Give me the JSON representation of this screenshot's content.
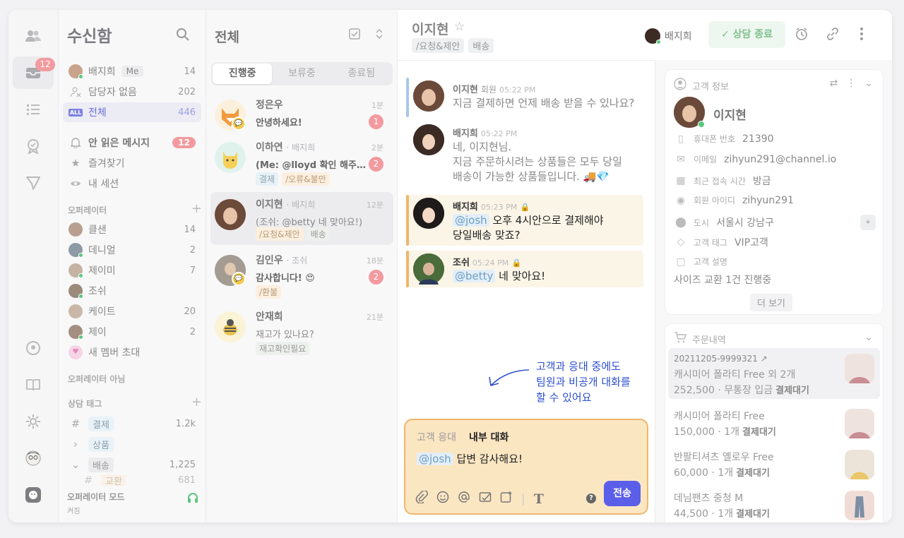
{
  "rail": {
    "inbox_badge": "12"
  },
  "sidebar": {
    "title": "수신함",
    "rows": [
      {
        "label": "배지희",
        "me": "Me",
        "count": "14"
      },
      {
        "label": "담당자 없음",
        "count": "202"
      },
      {
        "label": "전체",
        "count": "446"
      }
    ],
    "unread": {
      "label": "안 읽은 메시지",
      "badge": "12"
    },
    "favorites": "즐겨찾기",
    "my_session": "내 세션",
    "operators_title": "오퍼레이터",
    "operators": [
      {
        "name": "클샌",
        "count": "14"
      },
      {
        "name": "데니얼",
        "count": "2"
      },
      {
        "name": "제이미",
        "count": "7"
      },
      {
        "name": "조쉬",
        "count": ""
      },
      {
        "name": "케이트",
        "count": "20"
      },
      {
        "name": "제이",
        "count": "2"
      }
    ],
    "invite": "새 멤버 초대",
    "not_operator": "오퍼레이터 아님",
    "tags_title": "상담 태그",
    "tags": [
      {
        "label": "결제",
        "count": "1.2k"
      },
      {
        "label": "상품",
        "count": ""
      },
      {
        "label": "배송",
        "count": "1,225"
      },
      {
        "label": "교환",
        "count": "681"
      }
    ],
    "footer_title": "오퍼레이터 모드",
    "footer_sub": "켜짐"
  },
  "clist": {
    "title": "전체",
    "tabs": [
      "진행중",
      "보류중",
      "종료됨"
    ],
    "items": [
      {
        "name": "정은우",
        "sub": "",
        "time": "1분",
        "msg": "안녕하세요!",
        "badge": "1",
        "tags": []
      },
      {
        "name": "이하연",
        "sub": "· 배지희",
        "time": "2분",
        "msg": "(Me: @lloyd 확인 해주실...",
        "badge": "2",
        "tags": [
          "결제",
          "/오류&불만"
        ]
      },
      {
        "name": "이지현",
        "sub": "· 배지희",
        "time": "12분",
        "msg": "(조쉬: @betty 네 맞아요!)",
        "badge": "",
        "tags": [
          "/요청&제안",
          "배송"
        ]
      },
      {
        "name": "김인우",
        "sub": "· 조쉬",
        "time": "18분",
        "msg": "감사합니다! 😍",
        "badge": "2",
        "tags": [
          "/환불"
        ]
      },
      {
        "name": "안재희",
        "sub": "",
        "time": "21분",
        "msg": "재고가 있나요?",
        "badge": "",
        "tags": [
          "재고확인필요"
        ]
      }
    ]
  },
  "chat": {
    "name": "이지현",
    "tags": [
      "/요청&제안",
      "배송"
    ],
    "messages": [
      {
        "who": "이지현",
        "role": "회원",
        "time": "05:22 PM",
        "text": "지금 결제하면 언제 배송 받을 수 있나요?"
      },
      {
        "who": "배지희",
        "role": "",
        "time": "05:22 PM",
        "l1": "네, 이지현님.",
        "l2": "지금 주문하시려는 상품들은 모두 당일",
        "l3": "배송이 가능한 상품들입니다. 🚚💎"
      },
      {
        "who": "배지희",
        "role": "",
        "time": "05:23 PM",
        "mention": "@josh",
        "l1": " 오후 4시안으로 결제해야",
        "l2": "당일배송 맞죠?"
      },
      {
        "who": "조쉬",
        "role": "",
        "time": "05:24 PM",
        "mention": "@betty",
        "l1": " 네 맞아요!"
      }
    ],
    "note": [
      "고객과 응대 중에도",
      "팀원과 비공개 대화를",
      "할 수 있어요"
    ],
    "composer": {
      "tab_customer": "고객 응대",
      "tab_internal": "내부 대화",
      "mention": "@josh",
      "text": " 답변 감사해요!",
      "send": "전송"
    }
  },
  "header": {
    "assignee": "배지희",
    "close": "✓  상담 종료"
  },
  "profile": {
    "title": "고객 정보",
    "name": "이지현",
    "rows": [
      {
        "label": "휴대폰 번호",
        "value": "21390"
      },
      {
        "label": "이메일",
        "value": "zihyun291@channel.io"
      },
      {
        "label": "최근 접속 시간",
        "value": "방금"
      },
      {
        "label": "회원 아이디",
        "value": "zihyun291"
      },
      {
        "label": "도시",
        "value": "서울시 강남구"
      },
      {
        "label": "고객 태그",
        "value": "VIP고객"
      },
      {
        "label": "고객 설명",
        "value": ""
      }
    ],
    "desc": "사이즈 교환 1건 진행중",
    "more": "더 보기"
  },
  "orders": {
    "title": "주문내역",
    "items": [
      {
        "l0": "20211205-9999321 ↗",
        "l1": "캐시미어 폴라티 Free 외 2개",
        "l2": "252,500 · 무통장 입금",
        "status": "결제대기"
      },
      {
        "l0": "",
        "l1": "캐시미어 폴라티 Free",
        "l2": "150,000 · 1개",
        "status": "결제대기"
      },
      {
        "l0": "",
        "l1": "반팔티셔츠 옐로우 Free",
        "l2": "60,000 · 1개",
        "status": "결제대기"
      },
      {
        "l0": "",
        "l1": "데님팬츠 중청 M",
        "l2": "44,500 · 1개",
        "status": "결제대기"
      }
    ]
  }
}
